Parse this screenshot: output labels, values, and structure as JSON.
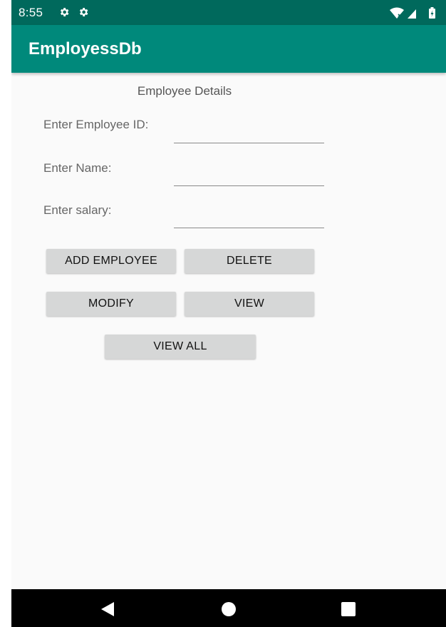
{
  "status_bar": {
    "time": "8:55",
    "icons": [
      "gear-icon",
      "gear-icon",
      "wifi-icon",
      "signal-icon",
      "battery-charging-icon"
    ]
  },
  "app_bar": {
    "title": "EmployessDb"
  },
  "form": {
    "heading": "Employee Details",
    "employee_id_label": "Enter Employee ID:",
    "employee_id_value": "",
    "name_label": "Enter Name:",
    "name_value": "",
    "salary_label": "Enter salary:",
    "salary_value": ""
  },
  "buttons": {
    "add_employee": "ADD EMPLOYEE",
    "delete": "DELETE",
    "modify": "MODIFY",
    "view": "VIEW",
    "view_all": "VIEW ALL"
  },
  "nav_bar": {
    "icons": [
      "back-icon",
      "home-icon",
      "recents-icon"
    ]
  },
  "colors": {
    "status_bar": "#00695c",
    "app_bar": "#00897b",
    "background": "#fafafa",
    "button": "#d6d7d7",
    "nav_bar": "#000000"
  }
}
